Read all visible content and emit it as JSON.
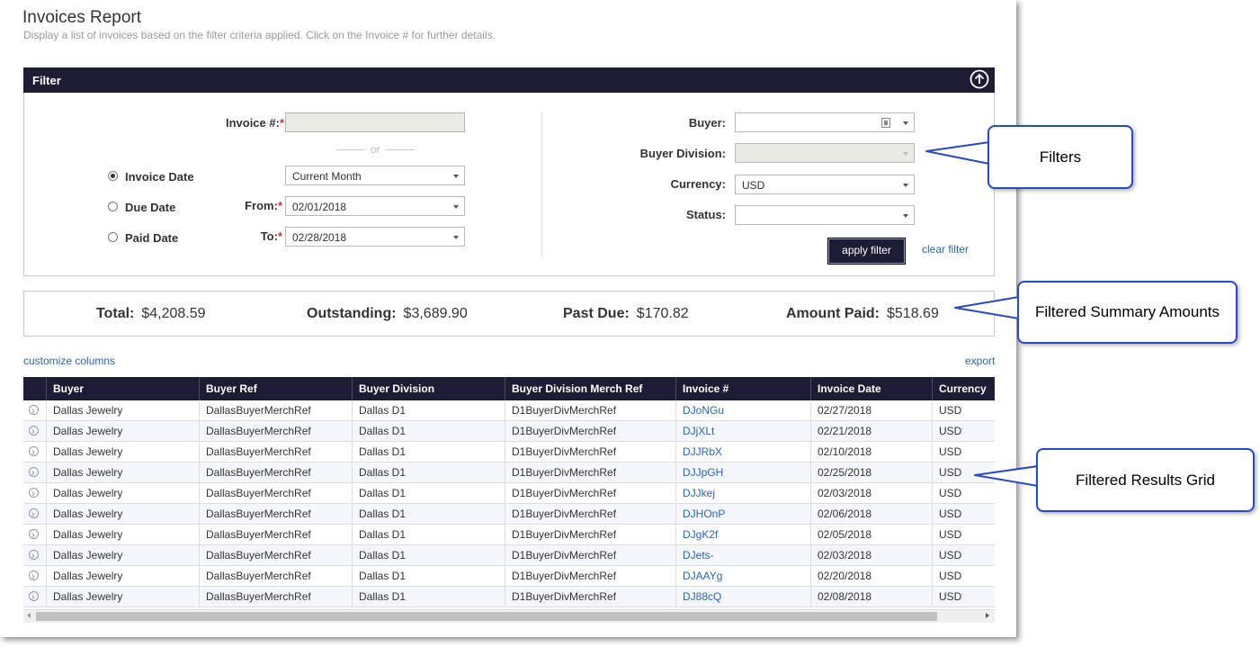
{
  "page": {
    "title": "Invoices Report",
    "subtitle": "Display a list of invoices based on the filter criteria applied. Click on the Invoice # for further details."
  },
  "filter": {
    "title": "Filter",
    "invoice_label": "Invoice #:",
    "invoice_value": "",
    "or_text": "or",
    "radio_invoice_date": "Invoice Date",
    "radio_due_date": "Due Date",
    "radio_paid_date": "Paid Date",
    "period_value": "Current Month",
    "from_label": "From:",
    "from_value": "02/01/2018",
    "to_label": "To:",
    "to_value": "02/28/2018",
    "buyer_label": "Buyer:",
    "buyer_value": "",
    "buyer_division_label": "Buyer Division:",
    "buyer_division_value": "",
    "currency_label": "Currency:",
    "currency_value": "USD",
    "status_label": "Status:",
    "status_value": "",
    "apply_label": "apply filter",
    "clear_label": "clear filter",
    "required_mark": "*"
  },
  "summary": {
    "total_label": "Total:",
    "total_value": "$4,208.59",
    "outstanding_label": "Outstanding:",
    "outstanding_value": "$3,689.90",
    "past_due_label": "Past Due:",
    "past_due_value": "$170.82",
    "amount_paid_label": "Amount Paid:",
    "amount_paid_value": "$518.69"
  },
  "grid": {
    "customize_label": "customize columns",
    "export_label": "export",
    "columns": [
      "Buyer",
      "Buyer Ref",
      "Buyer Division",
      "Buyer Division Merch Ref",
      "Invoice #",
      "Invoice Date",
      "Currency"
    ],
    "rows": [
      [
        "Dallas Jewelry",
        "DallasBuyerMerchRef",
        "Dallas D1",
        "D1BuyerDivMerchRef",
        "DJoNGu",
        "02/27/2018",
        "USD"
      ],
      [
        "Dallas Jewelry",
        "DallasBuyerMerchRef",
        "Dallas D1",
        "D1BuyerDivMerchRef",
        "DJjXLt",
        "02/21/2018",
        "USD"
      ],
      [
        "Dallas Jewelry",
        "DallasBuyerMerchRef",
        "Dallas D1",
        "D1BuyerDivMerchRef",
        "DJJRbX",
        "02/10/2018",
        "USD"
      ],
      [
        "Dallas Jewelry",
        "DallasBuyerMerchRef",
        "Dallas D1",
        "D1BuyerDivMerchRef",
        "DJJpGH",
        "02/25/2018",
        "USD"
      ],
      [
        "Dallas Jewelry",
        "DallasBuyerMerchRef",
        "Dallas D1",
        "D1BuyerDivMerchRef",
        "DJJkej",
        "02/03/2018",
        "USD"
      ],
      [
        "Dallas Jewelry",
        "DallasBuyerMerchRef",
        "Dallas D1",
        "D1BuyerDivMerchRef",
        "DJHOnP",
        "02/06/2018",
        "USD"
      ],
      [
        "Dallas Jewelry",
        "DallasBuyerMerchRef",
        "Dallas D1",
        "D1BuyerDivMerchRef",
        "DJgK2f",
        "02/05/2018",
        "USD"
      ],
      [
        "Dallas Jewelry",
        "DallasBuyerMerchRef",
        "Dallas D1",
        "D1BuyerDivMerchRef",
        "DJets-",
        "02/03/2018",
        "USD"
      ],
      [
        "Dallas Jewelry",
        "DallasBuyerMerchRef",
        "Dallas D1",
        "D1BuyerDivMerchRef",
        "DJAAYg",
        "02/20/2018",
        "USD"
      ],
      [
        "Dallas Jewelry",
        "DallasBuyerMerchRef",
        "Dallas D1",
        "D1BuyerDivMerchRef",
        "DJ88cQ",
        "02/08/2018",
        "USD"
      ]
    ]
  },
  "callouts": {
    "filters": "Filters",
    "summary": "Filtered Summary Amounts",
    "grid": "Filtered Results Grid"
  },
  "colors": {
    "header_bg": "#1c1c34",
    "link": "#2a66b0",
    "callout_border": "#2a48c7"
  }
}
